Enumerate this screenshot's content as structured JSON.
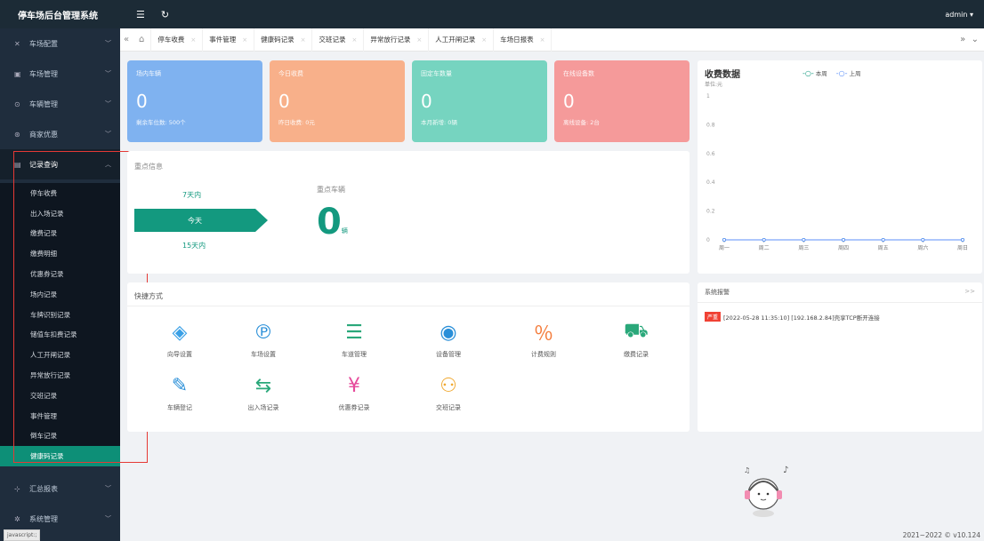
{
  "app": {
    "title": "停车场后台管理系统",
    "user": "admin",
    "copyright": "2021~2022 © v10.124",
    "js_tip": "javascript:;"
  },
  "sidebar": {
    "menu_top": [
      {
        "label": "车场配置",
        "icon": "x-config-icon"
      },
      {
        "label": "车场管理",
        "icon": "parking-icon"
      },
      {
        "label": "车辆管理",
        "icon": "car-icon"
      },
      {
        "label": "商家优惠",
        "icon": "discount-icon"
      },
      {
        "label": "记录查询",
        "icon": "record-icon"
      }
    ],
    "submenu": [
      "停车收费",
      "出入场记录",
      "缴费记录",
      "缴费明细",
      "优惠券记录",
      "场内记录",
      "车牌识别记录",
      "储值车扣费记录",
      "人工开闸记录",
      "异常放行记录",
      "交班记录",
      "事件管理",
      "倒车记录",
      "健康码记录"
    ],
    "menu_bottom": [
      {
        "label": "汇总报表",
        "icon": "report-icon"
      },
      {
        "label": "系统管理",
        "icon": "settings-icon"
      }
    ]
  },
  "tabs": [
    "停车收费",
    "事件管理",
    "健康码记录",
    "交班记录",
    "异常放行记录",
    "人工开闸记录",
    "车场日报表"
  ],
  "cards": [
    {
      "title": "场内车辆",
      "value": "0",
      "sub": "剩余车位数: 500个",
      "color": "#7fb2f0"
    },
    {
      "title": "今日收费",
      "value": "0",
      "sub": "昨日收费: 0元",
      "color": "#f8b08a"
    },
    {
      "title": "固定车数量",
      "value": "0",
      "sub": "本月新增: 0辆",
      "color": "#76d4c0"
    },
    {
      "title": "在线设备数",
      "value": "0",
      "sub": "离线设备: 2台",
      "color": "#f59a9a"
    }
  ],
  "focus": {
    "title": "重点信息",
    "options": [
      "7天内",
      "今天",
      "15天内"
    ],
    "car_title": "重点车辆",
    "car_value": "0",
    "car_unit": "辆"
  },
  "shortcuts": {
    "title": "快捷方式",
    "items": [
      {
        "label": "向导设置",
        "icon": "compass-icon",
        "color": "#3aa0e6"
      },
      {
        "label": "车场设置",
        "icon": "parking-settings-icon",
        "color": "#2a8fd8"
      },
      {
        "label": "车道管理",
        "icon": "lane-icon",
        "color": "#2aa87a"
      },
      {
        "label": "设备管理",
        "icon": "camera-icon",
        "color": "#2a8fd8"
      },
      {
        "label": "计费规则",
        "icon": "billing-icon",
        "color": "#f47b3a"
      },
      {
        "label": "缴费记录",
        "icon": "payment-record-icon",
        "color": "#2aa87a"
      },
      {
        "label": "车辆登记",
        "icon": "register-icon",
        "color": "#2a8fd8"
      },
      {
        "label": "出入场记录",
        "icon": "in-out-icon",
        "color": "#2aa87a"
      },
      {
        "label": "优惠券记录",
        "icon": "coupon-icon",
        "color": "#e64a9b"
      },
      {
        "label": "交班记录",
        "icon": "handover-icon",
        "color": "#f0a830"
      }
    ]
  },
  "alerts": {
    "title": "系统报警",
    "more": ">>",
    "badge": "严重",
    "message": "[2022-05-28 11:35:10] [192.168.2.84]壳享TCP断开连接"
  },
  "chart_data": {
    "type": "line",
    "title": "收费数据",
    "ylabel": "单位:元",
    "categories": [
      "周一",
      "周二",
      "周三",
      "周四",
      "周五",
      "周六",
      "周日"
    ],
    "series": [
      {
        "name": "本周",
        "values": [
          0,
          0,
          0,
          0,
          0,
          0,
          0
        ],
        "color": "#13997f"
      },
      {
        "name": "上周",
        "values": [
          0,
          0,
          0,
          0,
          0,
          0,
          0
        ],
        "color": "#5b8ff9"
      }
    ],
    "ylim": [
      0,
      1
    ],
    "yticks": [
      "0",
      "0.2",
      "0.4",
      "0.6",
      "0.8",
      "1"
    ],
    "legend": "top"
  }
}
